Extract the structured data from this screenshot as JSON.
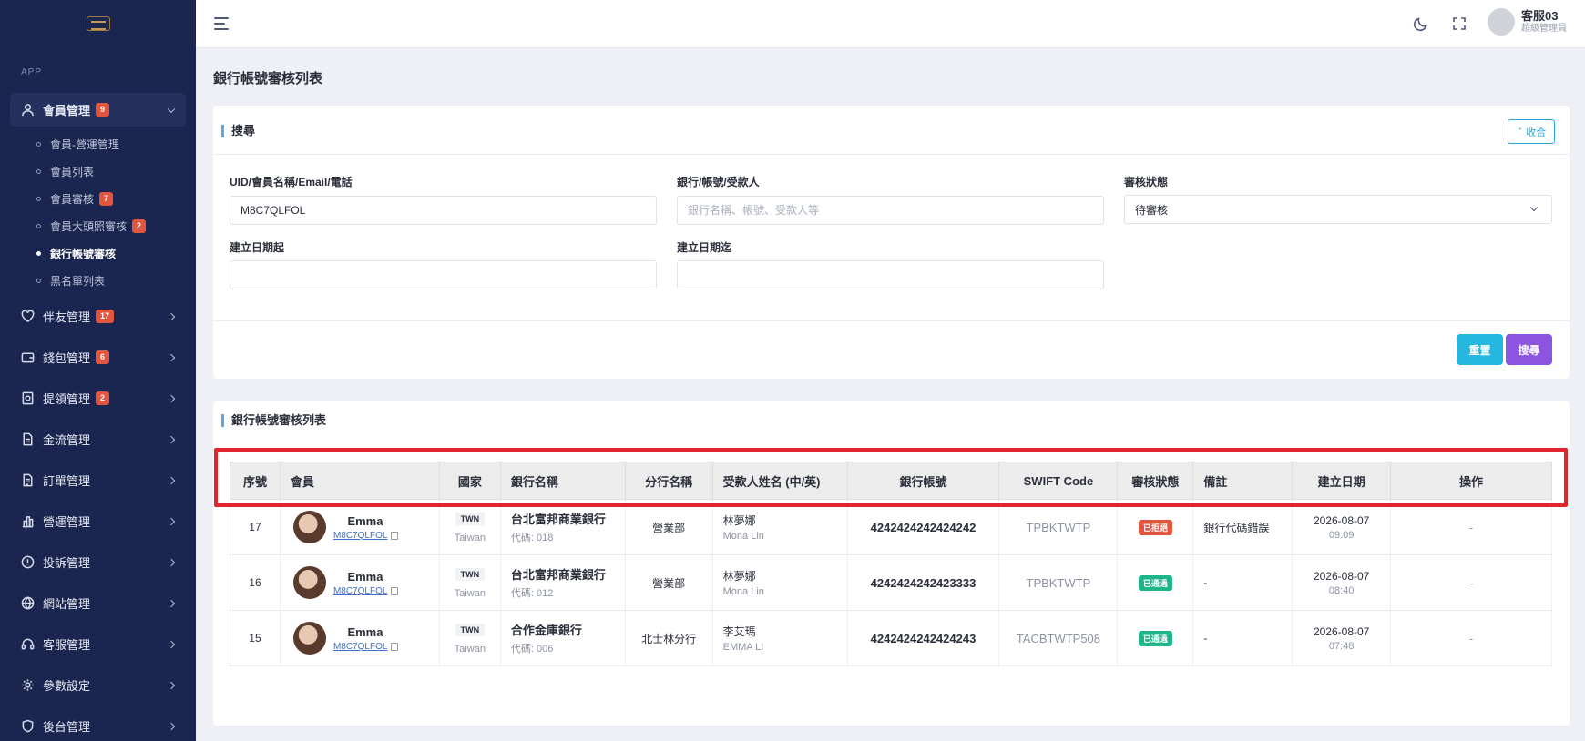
{
  "sidebar": {
    "section": "APP",
    "active_menu": {
      "label": "會員管理",
      "badge": "9",
      "icon": "user-icon"
    },
    "submenu": [
      {
        "label": "會員-營運管理",
        "badge": ""
      },
      {
        "label": "會員列表",
        "badge": ""
      },
      {
        "label": "會員審核",
        "badge": "7"
      },
      {
        "label": "會員大頭照審核",
        "badge": "2"
      },
      {
        "label": "銀行帳號審核",
        "badge": ""
      },
      {
        "label": "黑名單列表",
        "badge": ""
      }
    ],
    "menu": [
      {
        "label": "伴友管理",
        "badge": "17",
        "icon": "heart-icon"
      },
      {
        "label": "錢包管理",
        "badge": "6",
        "icon": "wallet-icon"
      },
      {
        "label": "提領管理",
        "badge": "2",
        "icon": "withdraw-icon"
      },
      {
        "label": "金流管理",
        "badge": "",
        "icon": "document-icon"
      },
      {
        "label": "訂單管理",
        "badge": "",
        "icon": "order-icon"
      },
      {
        "label": "營運管理",
        "badge": "",
        "icon": "bar-chart-icon"
      },
      {
        "label": "投訴管理",
        "badge": "",
        "icon": "alert-icon"
      },
      {
        "label": "網站管理",
        "badge": "",
        "icon": "globe-icon"
      },
      {
        "label": "客服管理",
        "badge": "",
        "icon": "headset-icon"
      },
      {
        "label": "參數設定",
        "badge": "",
        "icon": "gear-icon"
      },
      {
        "label": "後台管理",
        "badge": "",
        "icon": "shield-icon"
      }
    ]
  },
  "topbar": {
    "user_name": "客服03",
    "user_role": "超級管理員"
  },
  "page": {
    "title": "銀行帳號審核列表"
  },
  "search": {
    "title": "搜尋",
    "collapse_label": "收合",
    "uid_label": "UID/會員名稱/Email/電話",
    "uid_value": "M8C7QLFOL",
    "bank_label": "銀行/帳號/受款人",
    "bank_placeholder": "銀行名稱、帳號、受款人等",
    "status_label": "審核狀態",
    "status_value": "待審核",
    "date_from_label": "建立日期起",
    "date_to_label": "建立日期迄",
    "reset_label": "重置",
    "search_label": "搜尋"
  },
  "list": {
    "title": "銀行帳號審核列表",
    "headers": [
      "序號",
      "會員",
      "國家",
      "銀行名稱",
      "分行名稱",
      "受款人姓名 (中/英)",
      "銀行帳號",
      "SWIFT Code",
      "審核狀態",
      "備註",
      "建立日期",
      "操作"
    ],
    "rows": [
      {
        "no": "17",
        "name": "Emma",
        "uid": "M8C7QLFOL",
        "country_code": "TWN",
        "country": "Taiwan",
        "bank": "台北富邦商業銀行",
        "bank_code": "代碼: 018",
        "branch": "營業部",
        "payee_zh": "林夢娜",
        "payee_en": "Mona Lin",
        "account": "4242424242424242",
        "swift": "TPBKTWTP",
        "status": "已拒絕",
        "status_color": "#e2553f",
        "note": "銀行代碼錯誤",
        "date": "2026-08-07",
        "time": "09:09",
        "action": "-"
      },
      {
        "no": "16",
        "name": "Emma",
        "uid": "M8C7QLFOL",
        "country_code": "TWN",
        "country": "Taiwan",
        "bank": "台北富邦商業銀行",
        "bank_code": "代碼: 012",
        "branch": "營業部",
        "payee_zh": "林夢娜",
        "payee_en": "Mona Lin",
        "account": "4242424242423333",
        "swift": "TPBKTWTP",
        "status": "已通過",
        "status_color": "#1fb58b",
        "note": "-",
        "date": "2026-08-07",
        "time": "08:40",
        "action": "-"
      },
      {
        "no": "15",
        "name": "Emma",
        "uid": "M8C7QLFOL",
        "country_code": "TWN",
        "country": "Taiwan",
        "bank": "合作金庫銀行",
        "bank_code": "代碼: 006",
        "branch": "北士林分行",
        "payee_zh": "李艾瑪",
        "payee_en": "EMMA LI",
        "account": "4242424242424243",
        "swift": "TACBTWTP508",
        "status": "已通過",
        "status_color": "#1fb58b",
        "note": "-",
        "date": "2026-08-07",
        "time": "07:48",
        "action": "-"
      }
    ]
  },
  "colors": {
    "sidebar_bg": "#1a2650",
    "accent_cyan": "#25b7e0",
    "accent_purple": "#8b55e0",
    "highlight": "#e0262c"
  }
}
